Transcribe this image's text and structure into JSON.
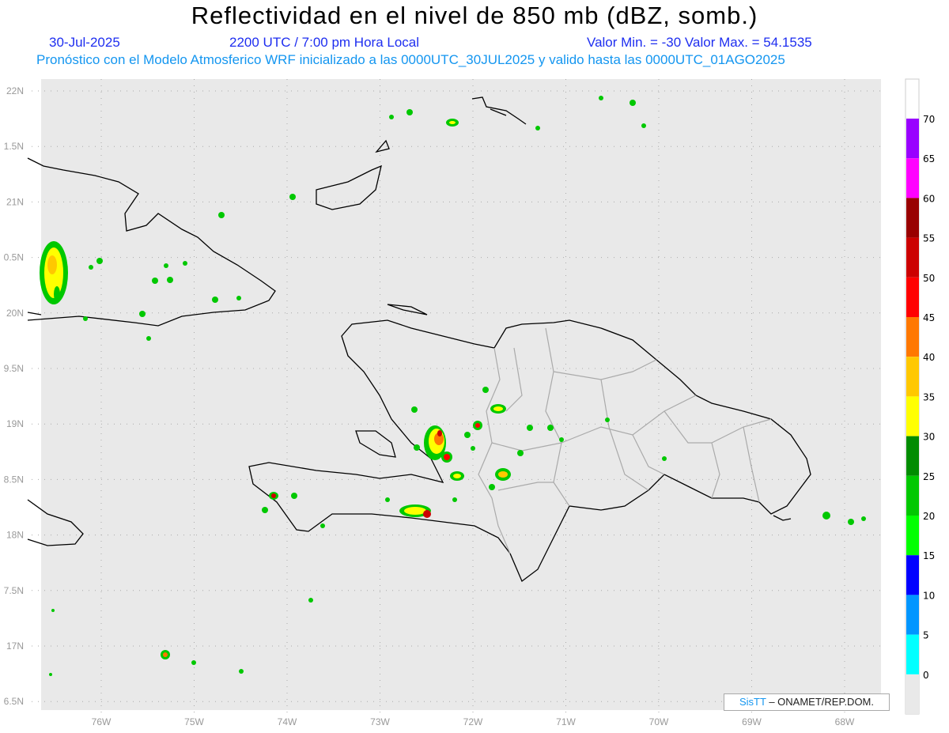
{
  "title": "Reflectividad en el nivel de 850 mb (dBZ, somb.)",
  "date": "30-Jul-2025",
  "time": "2200 UTC / 7:00 pm Hora Local",
  "min_max": "Valor Min. = -30  Valor Max. = 54.1535",
  "forecast_info": "Pronóstico con el Modelo Atmosferico WRF inicializado a las 0000UTC_30JUL2025 y valido hasta las  0000UTC_01AGO2025",
  "credit": {
    "brand": "SisTT",
    "text": "– ONAMET/REP.DOM."
  },
  "map": {
    "lat_labels": [
      "22N",
      "1.5N",
      "21N",
      "0.5N",
      "20N",
      "9.5N",
      "19N",
      "8.5N",
      "18N",
      "7.5N",
      "17N",
      "6.5N"
    ],
    "lon_labels": [
      "76W",
      "75W",
      "74W",
      "73W",
      "72W",
      "71W",
      "70W",
      "69W",
      "68W"
    ]
  },
  "colorbar": {
    "labels": [
      "70",
      "65",
      "60",
      "55",
      "50",
      "45",
      "40",
      "35",
      "30",
      "25",
      "20",
      "15",
      "10",
      "5",
      "0"
    ],
    "colors": [
      "#9900ff",
      "#ff00ff",
      "#990000",
      "#cc0000",
      "#ff0000",
      "#ff7800",
      "#ffc800",
      "#ffff00",
      "#008c00",
      "#00c800",
      "#00ff00",
      "#0000ff",
      "#0096ff",
      "#00ffff"
    ]
  }
}
